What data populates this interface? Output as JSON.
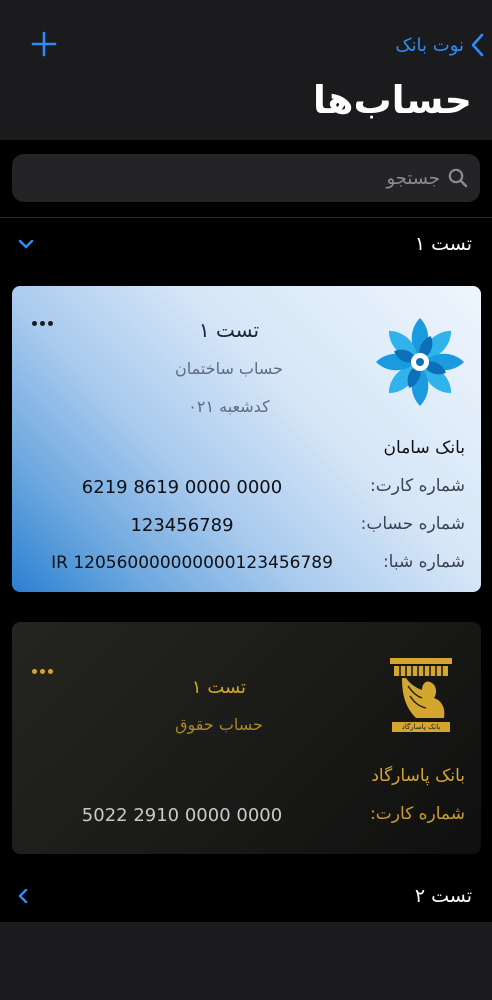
{
  "nav": {
    "back_label": "نوت بانک",
    "title": "حساب‌ها"
  },
  "search": {
    "placeholder": "جستجو"
  },
  "sections": [
    {
      "title": "تست ۱",
      "expanded": true
    },
    {
      "title": "تست ۲",
      "expanded": false
    }
  ],
  "cards": {
    "saman": {
      "name": "تست ۱",
      "account_type": "حساب ساختمان",
      "branch_code": "کدشعبه ۰۲۱",
      "bank": "بانک سامان",
      "card_label": "شماره کارت:",
      "card_number": "6219 8619 0000 0000",
      "account_label": "شماره حساب:",
      "account_number": "123456789",
      "sheba_label": "شماره شبا:",
      "sheba_number": "IR 120560000000000123456789",
      "logo_icon": "saman-flower-logo",
      "gradient": [
        "#2b7fd0",
        "#eef5fd"
      ]
    },
    "pasargad": {
      "name": "تست ۱",
      "account_type": "حساب حقوق",
      "bank": "بانک پاسارگاد",
      "logo_caption": "بانک پاسارگاد",
      "card_label": "شماره کارت:",
      "card_number": "5022 2910 0000 0000",
      "logo_icon": "pasargad-griffin-logo",
      "accent": "#d4a630"
    }
  },
  "colors": {
    "accent": "#2f8cf6",
    "background": "#000000",
    "bar": "#1b1b1d"
  }
}
